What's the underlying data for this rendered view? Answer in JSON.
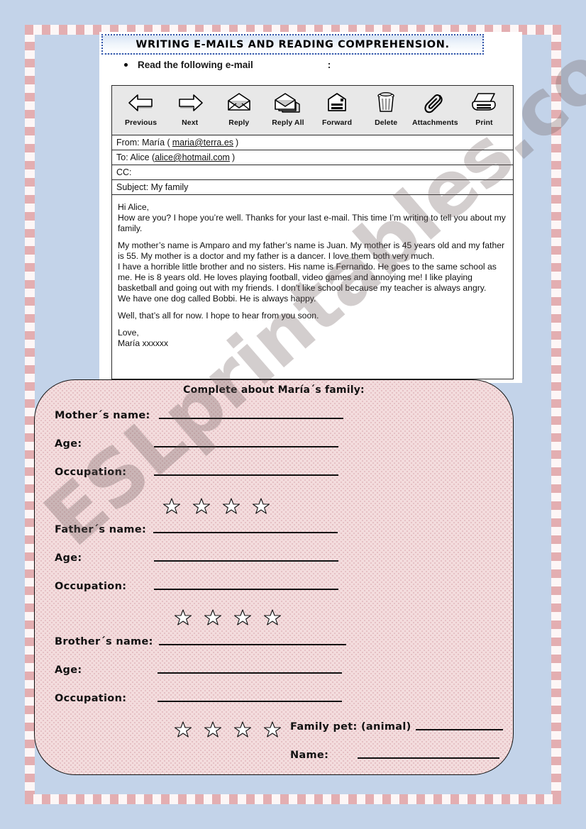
{
  "page": {
    "background_color": "#c3d3e9",
    "frame_color": "#e3aeb1"
  },
  "title": {
    "text": "WRITING E-MAILS AND READING COMPREHENSION."
  },
  "instruction": {
    "text": "Read the following e-mail",
    "colon": ":"
  },
  "email_client": {
    "toolbar": [
      {
        "label": "Previous",
        "icon": "arrow-left-icon"
      },
      {
        "label": "Next",
        "icon": "arrow-right-icon"
      },
      {
        "label": "Reply",
        "icon": "envelope-open-icon"
      },
      {
        "label": "Reply All",
        "icon": "envelopes-stack-icon"
      },
      {
        "label": "Forward",
        "icon": "envelope-forward-icon"
      },
      {
        "label": "Delete",
        "icon": "trash-can-icon"
      },
      {
        "label": "Attachments",
        "icon": "paperclip-icon"
      },
      {
        "label": "Print",
        "icon": "printer-icon"
      }
    ],
    "headers": {
      "from_label": "From: María (",
      "from_address": "maria@terra.es",
      "from_close": ")",
      "to_label": "To: Alice (",
      "to_address": "alice@hotmail.com",
      "to_close": ")",
      "cc_label": "CC:",
      "subject_label": "Subject: My family"
    },
    "body": {
      "greeting": "Hi Alice,",
      "paragraph1": "How are you? I hope you’re well. Thanks for your last e-mail. This time I’m writing to tell you about my family.",
      "paragraph2": "My mother’s name is Amparo and my father’s name is Juan. My mother is 45 years old and my father is 55. My mother is a doctor and my father is a dancer. I love them both very much.",
      "paragraph3": "I have a horrible little brother and no sisters. His name is Fernando. He goes to the same school as me. He is 8 years old. He loves playing football, video games and annoying me! I like playing basketball and going out with my friends. I don’t like school because my teacher is always angry.",
      "paragraph4": "We have one dog called Bobbi. He is always happy.",
      "paragraph5": "Well, that’s all for now. I hope to hear from you soon.",
      "signoff": "Love,",
      "signature": "María xxxxxx"
    }
  },
  "worksheet": {
    "heading": "Complete about María´s family:",
    "rows": [
      {
        "label": "Mother´s name:"
      },
      {
        "label": "Age:"
      },
      {
        "label": "Occupation:"
      },
      {
        "label": "Father´s name:"
      },
      {
        "label": "Age:"
      },
      {
        "label": "Occupation:"
      },
      {
        "label": "Brother´s name:"
      },
      {
        "label": "Age:"
      },
      {
        "label": "Occupation:"
      }
    ],
    "pet": {
      "label": "Family pet: (animal)",
      "name_label": "Name:"
    },
    "star_count": 4
  },
  "watermark": {
    "text": "ESLprintables.com"
  }
}
